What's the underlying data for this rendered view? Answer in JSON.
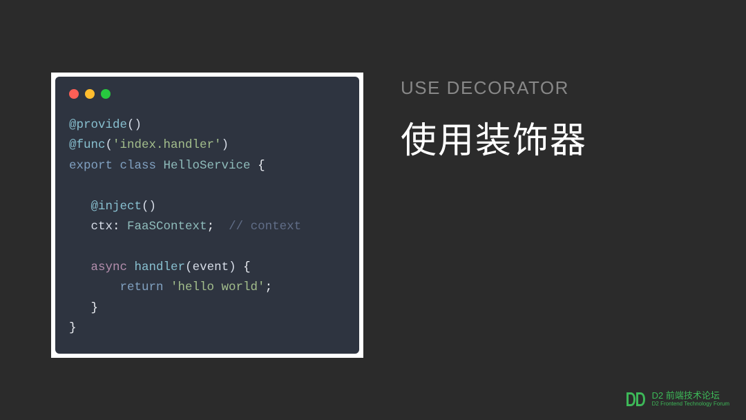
{
  "subtitle": "USE DECORATOR",
  "title": "使用装饰器",
  "code": {
    "line1_deco": "@provide",
    "line1_paren": "()",
    "line2_deco": "@func",
    "line2_paren_open": "(",
    "line2_str": "'index.handler'",
    "line2_paren_close": ")",
    "line3_export": "export",
    "line3_class": " class ",
    "line3_name": "HelloService",
    "line3_brace": " {",
    "line5_deco": "@inject",
    "line5_paren": "()",
    "line6_prop": "ctx",
    "line6_colon": ": ",
    "line6_type": "FaaSContext",
    "line6_semi": ";  ",
    "line6_comment": "// context",
    "line8_async": "async",
    "line8_method": " handler",
    "line8_paren_open": "(",
    "line8_param": "event",
    "line8_paren_close": ")",
    "line8_brace": " {",
    "line9_return": "return",
    "line9_str": " 'hello world'",
    "line9_semi": ";",
    "line10_brace": "}",
    "line11_brace": "}"
  },
  "footer": {
    "logo_top": "D2 前端技术论坛",
    "logo_bottom": "D2 Frontend Technology Forum"
  }
}
